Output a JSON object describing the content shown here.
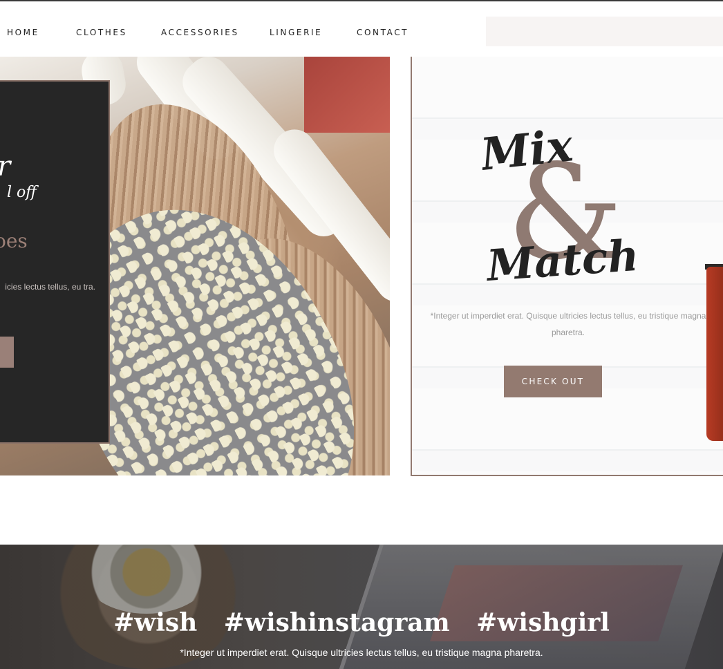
{
  "nav": {
    "items": [
      "HOME",
      "CLOTHES",
      "ACCESSORIES",
      "LINGERIE",
      "CONTACT"
    ]
  },
  "promo": {
    "script_text": "r",
    "off_text": "l off",
    "word": "oes",
    "description": "icies lectus tellus, eu tra."
  },
  "mix_match": {
    "logo": {
      "mix": "Mix",
      "ampersand": "&",
      "match": "Match"
    },
    "description": "*Integer ut imperdiet erat. Quisque ultricies lectus tellus, eu tristique magna pharetra.",
    "button_label": "CHECK OUT"
  },
  "instagram": {
    "hashtags": [
      "#wish",
      "#wishinstagram",
      "#wishgirl"
    ],
    "caption": "*Integer ut imperdiet erat. Quisque ultricies lectus tellus, eu tristique magna pharetra."
  },
  "colors": {
    "accent": "#937a70",
    "dark": "#262626",
    "search_bg": "#f7f4f3"
  }
}
